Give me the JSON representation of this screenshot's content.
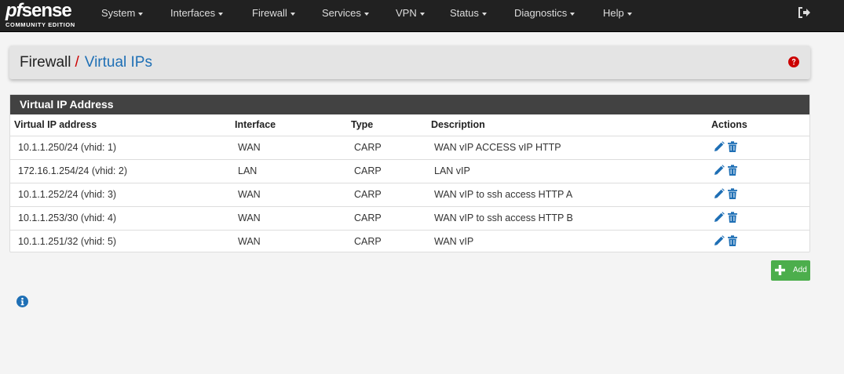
{
  "brand": {
    "name_pf": "pf",
    "name_rest": "sense",
    "edition": "COMMUNITY EDITION"
  },
  "nav": {
    "items": [
      {
        "label": "System"
      },
      {
        "label": "Interfaces"
      },
      {
        "label": "Firewall"
      },
      {
        "label": "Services"
      },
      {
        "label": "VPN"
      },
      {
        "label": "Status"
      },
      {
        "label": "Diagnostics"
      },
      {
        "label": "Help"
      }
    ]
  },
  "breadcrumb": {
    "parent": "Firewall",
    "separator": "/",
    "current": "Virtual IPs"
  },
  "panel": {
    "title": "Virtual IP Address"
  },
  "table": {
    "headers": [
      "Virtual IP address",
      "Interface",
      "Type",
      "Description",
      "Actions"
    ],
    "rows": [
      {
        "address": "10.1.1.250/24 (vhid: 1)",
        "interface": "WAN",
        "type": "CARP",
        "description": "WAN vIP ACCESS vIP HTTP"
      },
      {
        "address": "172.16.1.254/24 (vhid: 2)",
        "interface": "LAN",
        "type": "CARP",
        "description": "LAN vIP"
      },
      {
        "address": "10.1.1.252/24 (vhid: 3)",
        "interface": "WAN",
        "type": "CARP",
        "description": "WAN vIP to ssh access HTTP A"
      },
      {
        "address": "10.1.1.253/30 (vhid: 4)",
        "interface": "WAN",
        "type": "CARP",
        "description": "WAN vIP to ssh access HTTP B"
      },
      {
        "address": "10.1.1.251/32 (vhid: 5)",
        "interface": "WAN",
        "type": "CARP",
        "description": "WAN vIP"
      }
    ]
  },
  "buttons": {
    "add_label": "Add"
  },
  "colors": {
    "navbar": "#212121",
    "link": "#1e6fb5",
    "success": "#4cae4c",
    "danger": "#c00"
  },
  "icons": {
    "logout": "sign-out-icon",
    "help": "question-circle-icon",
    "edit": "pencil-icon",
    "delete": "trash-icon",
    "add": "plus-icon",
    "info": "info-circle-icon"
  }
}
